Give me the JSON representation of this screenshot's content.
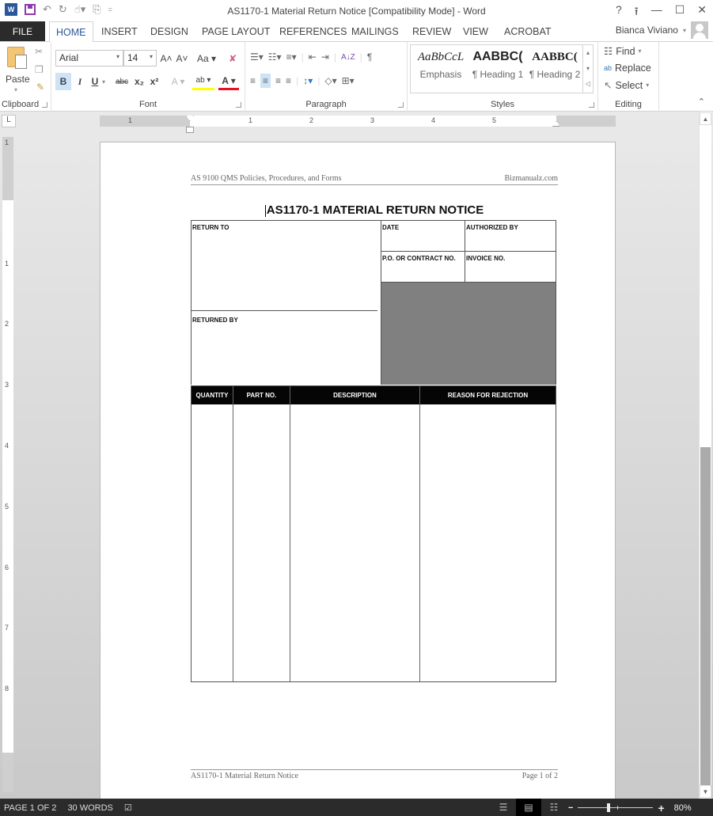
{
  "titlebar": {
    "title": "AS1170-1 Material Return Notice [Compatibility Mode] - Word",
    "app_icon": "W",
    "qat": {
      "save": "save-icon",
      "undo": "↶",
      "undo_dd": "·",
      "redo": "↻",
      "touch": "☝▾",
      "copy": "⎘",
      "customize": "⨪"
    },
    "controls": {
      "help": "?",
      "ribbon_display": "⭱",
      "minimize": "—",
      "maximize": "☐",
      "close": "✕"
    }
  },
  "tabs": {
    "file": "FILE",
    "items": [
      "HOME",
      "INSERT",
      "DESIGN",
      "PAGE LAYOUT",
      "REFERENCES",
      "MAILINGS",
      "REVIEW",
      "VIEW",
      "ACROBAT"
    ],
    "active": "HOME",
    "user": "Bianca Viviano",
    "user_dd": "▾"
  },
  "ribbon": {
    "clipboard": {
      "label": "Clipboard",
      "paste": "Paste",
      "paste_dd": "▾",
      "cut": "✂",
      "copy": "❐",
      "format_painter": "✎"
    },
    "font": {
      "label": "Font",
      "font_name": "Arial",
      "font_size": "14",
      "dd": "▾",
      "grow": "A˄",
      "shrink": "A˅",
      "change_case": "Aa ▾",
      "clear": "✘",
      "bold": "B",
      "italic": "I",
      "underline": "U",
      "underline_dd": "▾",
      "strike": "abc",
      "subscript": "x₂",
      "superscript": "x²",
      "effects": "A ▾",
      "highlight": "ab ▾",
      "font_color": "A ▾",
      "highlight_color": "#ffff00",
      "font_color_value": "#e81123"
    },
    "paragraph": {
      "label": "Paragraph",
      "row1": [
        "☰▾",
        "☷▾",
        "≡▾",
        "⇤",
        "⇥",
        "A↓Z",
        "¶"
      ],
      "row2": [
        "≡",
        "≡",
        "≡",
        "≡",
        "↕▾",
        "◇▾",
        "⊞▾"
      ]
    },
    "styles": {
      "label": "Styles",
      "items": [
        {
          "sample": "AaBbCcL",
          "name": "Emphasis"
        },
        {
          "sample": "AABBC(",
          "name": "¶ Heading 1"
        },
        {
          "sample": "AABBC(",
          "name": "¶ Heading 2"
        }
      ],
      "scroll": [
        "▴",
        "▾",
        "⨞"
      ]
    },
    "editing": {
      "label": "Editing",
      "find": "Find",
      "find_dd": "▾",
      "find_icon": "☷",
      "replace": "Replace",
      "replace_icon": "ab",
      "select": "Select",
      "select_dd": "▾",
      "select_icon": "↖"
    },
    "collapse": "⌃"
  },
  "rulers": {
    "corner": "L",
    "h_ticks": [
      "1",
      "1",
      "2",
      "3",
      "4",
      "5"
    ],
    "v_ticks": [
      "1",
      "1",
      "2",
      "3",
      "4",
      "5",
      "6",
      "7",
      "8"
    ]
  },
  "document": {
    "header_left": "AS 9100 QMS Policies, Procedures, and Forms",
    "header_right": "Bizmanualz.com",
    "title": "AS1170-1 MATERIAL RETURN NOTICE",
    "fields": {
      "return_to": "RETURN TO",
      "returned_by": "RETURNED BY",
      "date": "DATE",
      "authorized_by": "AUTHORIZED BY",
      "po_contract": "P.O. OR CONTRACT NO.",
      "invoice": "INVOICE NO."
    },
    "shaded_color": "#808080",
    "table": {
      "columns": [
        "QUANTITY",
        "PART NO.",
        "DESCRIPTION",
        "REASON FOR REJECTION"
      ],
      "rows": []
    },
    "footer_left": "AS1170-1 Material Return Notice",
    "footer_right": "Page 1 of 2"
  },
  "statusbar": {
    "page": "PAGE 1 OF 2",
    "words": "30 WORDS",
    "proof_icon": "☑",
    "views": [
      "☰",
      "▤",
      "☷"
    ],
    "zoom_minus": "−",
    "zoom_plus": "+",
    "zoom": "80%",
    "zoom_percent": 80
  },
  "scroll": {
    "up": "▲",
    "down": "▼"
  }
}
